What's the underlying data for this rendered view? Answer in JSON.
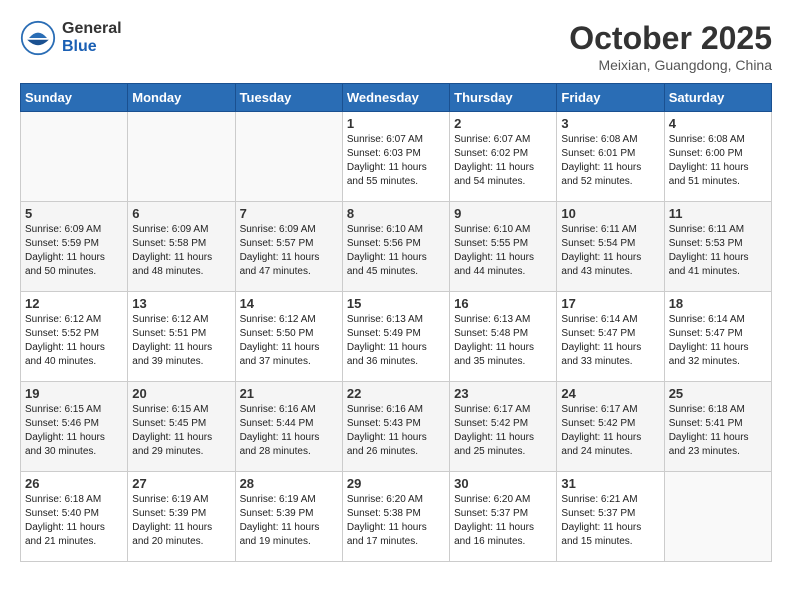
{
  "header": {
    "logo_general": "General",
    "logo_blue": "Blue",
    "month": "October 2025",
    "location": "Meixian, Guangdong, China"
  },
  "weekdays": [
    "Sunday",
    "Monday",
    "Tuesday",
    "Wednesday",
    "Thursday",
    "Friday",
    "Saturday"
  ],
  "weeks": [
    [
      {
        "day": "",
        "info": ""
      },
      {
        "day": "",
        "info": ""
      },
      {
        "day": "",
        "info": ""
      },
      {
        "day": "1",
        "info": "Sunrise: 6:07 AM\nSunset: 6:03 PM\nDaylight: 11 hours\nand 55 minutes."
      },
      {
        "day": "2",
        "info": "Sunrise: 6:07 AM\nSunset: 6:02 PM\nDaylight: 11 hours\nand 54 minutes."
      },
      {
        "day": "3",
        "info": "Sunrise: 6:08 AM\nSunset: 6:01 PM\nDaylight: 11 hours\nand 52 minutes."
      },
      {
        "day": "4",
        "info": "Sunrise: 6:08 AM\nSunset: 6:00 PM\nDaylight: 11 hours\nand 51 minutes."
      }
    ],
    [
      {
        "day": "5",
        "info": "Sunrise: 6:09 AM\nSunset: 5:59 PM\nDaylight: 11 hours\nand 50 minutes."
      },
      {
        "day": "6",
        "info": "Sunrise: 6:09 AM\nSunset: 5:58 PM\nDaylight: 11 hours\nand 48 minutes."
      },
      {
        "day": "7",
        "info": "Sunrise: 6:09 AM\nSunset: 5:57 PM\nDaylight: 11 hours\nand 47 minutes."
      },
      {
        "day": "8",
        "info": "Sunrise: 6:10 AM\nSunset: 5:56 PM\nDaylight: 11 hours\nand 45 minutes."
      },
      {
        "day": "9",
        "info": "Sunrise: 6:10 AM\nSunset: 5:55 PM\nDaylight: 11 hours\nand 44 minutes."
      },
      {
        "day": "10",
        "info": "Sunrise: 6:11 AM\nSunset: 5:54 PM\nDaylight: 11 hours\nand 43 minutes."
      },
      {
        "day": "11",
        "info": "Sunrise: 6:11 AM\nSunset: 5:53 PM\nDaylight: 11 hours\nand 41 minutes."
      }
    ],
    [
      {
        "day": "12",
        "info": "Sunrise: 6:12 AM\nSunset: 5:52 PM\nDaylight: 11 hours\nand 40 minutes."
      },
      {
        "day": "13",
        "info": "Sunrise: 6:12 AM\nSunset: 5:51 PM\nDaylight: 11 hours\nand 39 minutes."
      },
      {
        "day": "14",
        "info": "Sunrise: 6:12 AM\nSunset: 5:50 PM\nDaylight: 11 hours\nand 37 minutes."
      },
      {
        "day": "15",
        "info": "Sunrise: 6:13 AM\nSunset: 5:49 PM\nDaylight: 11 hours\nand 36 minutes."
      },
      {
        "day": "16",
        "info": "Sunrise: 6:13 AM\nSunset: 5:48 PM\nDaylight: 11 hours\nand 35 minutes."
      },
      {
        "day": "17",
        "info": "Sunrise: 6:14 AM\nSunset: 5:47 PM\nDaylight: 11 hours\nand 33 minutes."
      },
      {
        "day": "18",
        "info": "Sunrise: 6:14 AM\nSunset: 5:47 PM\nDaylight: 11 hours\nand 32 minutes."
      }
    ],
    [
      {
        "day": "19",
        "info": "Sunrise: 6:15 AM\nSunset: 5:46 PM\nDaylight: 11 hours\nand 30 minutes."
      },
      {
        "day": "20",
        "info": "Sunrise: 6:15 AM\nSunset: 5:45 PM\nDaylight: 11 hours\nand 29 minutes."
      },
      {
        "day": "21",
        "info": "Sunrise: 6:16 AM\nSunset: 5:44 PM\nDaylight: 11 hours\nand 28 minutes."
      },
      {
        "day": "22",
        "info": "Sunrise: 6:16 AM\nSunset: 5:43 PM\nDaylight: 11 hours\nand 26 minutes."
      },
      {
        "day": "23",
        "info": "Sunrise: 6:17 AM\nSunset: 5:42 PM\nDaylight: 11 hours\nand 25 minutes."
      },
      {
        "day": "24",
        "info": "Sunrise: 6:17 AM\nSunset: 5:42 PM\nDaylight: 11 hours\nand 24 minutes."
      },
      {
        "day": "25",
        "info": "Sunrise: 6:18 AM\nSunset: 5:41 PM\nDaylight: 11 hours\nand 23 minutes."
      }
    ],
    [
      {
        "day": "26",
        "info": "Sunrise: 6:18 AM\nSunset: 5:40 PM\nDaylight: 11 hours\nand 21 minutes."
      },
      {
        "day": "27",
        "info": "Sunrise: 6:19 AM\nSunset: 5:39 PM\nDaylight: 11 hours\nand 20 minutes."
      },
      {
        "day": "28",
        "info": "Sunrise: 6:19 AM\nSunset: 5:39 PM\nDaylight: 11 hours\nand 19 minutes."
      },
      {
        "day": "29",
        "info": "Sunrise: 6:20 AM\nSunset: 5:38 PM\nDaylight: 11 hours\nand 17 minutes."
      },
      {
        "day": "30",
        "info": "Sunrise: 6:20 AM\nSunset: 5:37 PM\nDaylight: 11 hours\nand 16 minutes."
      },
      {
        "day": "31",
        "info": "Sunrise: 6:21 AM\nSunset: 5:37 PM\nDaylight: 11 hours\nand 15 minutes."
      },
      {
        "day": "",
        "info": ""
      }
    ]
  ]
}
